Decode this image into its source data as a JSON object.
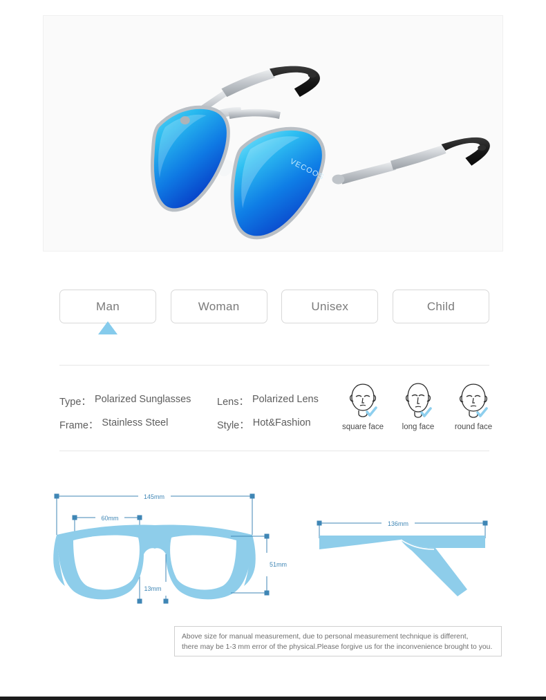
{
  "hero": {
    "alt": "polarized-aviator-sunglasses",
    "brand_on_lens": "VECOOS",
    "colors": {
      "panel_bg": "#fafafa",
      "lens_blue_light": "#3fc3f0",
      "lens_blue_deep": "#0a52d6",
      "frame_silver": "#c9ccd0",
      "tip_black": "#1a1a1a"
    }
  },
  "tabs": {
    "items": [
      {
        "label": "Man",
        "active": true
      },
      {
        "label": "Woman",
        "active": false
      },
      {
        "label": "Unisex",
        "active": false
      },
      {
        "label": "Child",
        "active": false
      }
    ],
    "pointer_color": "#85cbec"
  },
  "specs": {
    "rows": [
      [
        {
          "key": "Type：",
          "value": "Polarized Sunglasses"
        },
        {
          "key": "Lens：",
          "value": "Polarized Lens"
        }
      ],
      [
        {
          "key": "Frame：",
          "value": "Stainless Steel"
        },
        {
          "key": "Style：",
          "value": "Hot&Fashion"
        }
      ]
    ]
  },
  "faces": {
    "check_color": "#8ecfee",
    "items": [
      {
        "icon": "square-face-icon",
        "label": "square face"
      },
      {
        "icon": "long-face-icon",
        "label": "long face"
      },
      {
        "icon": "round-face-icon",
        "label": "round face"
      }
    ]
  },
  "measurements": {
    "diagram_color": "#8ecdea",
    "line_color": "#3f86b5",
    "front": {
      "total_width": "145mm",
      "lens_span": "60mm",
      "lens_height": "51mm",
      "bridge": "13mm"
    },
    "temple": {
      "length": "136mm"
    }
  },
  "note": {
    "line1": "Above size for manual measurement, due to personal measurement technique is different,",
    "line2": "there may be 1-3 mm error of the physical.Please forgive us for the inconvenience brought to you."
  }
}
